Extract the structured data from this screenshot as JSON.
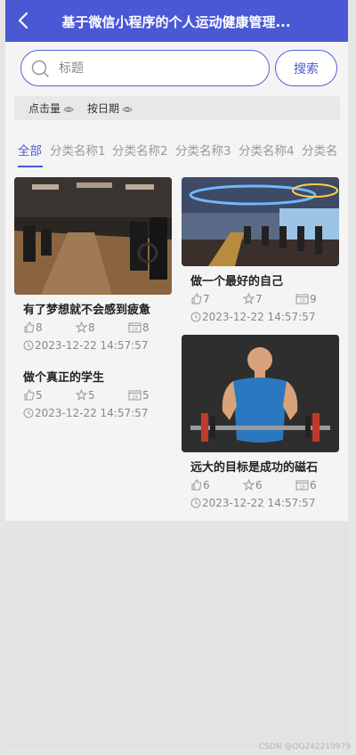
{
  "header": {
    "title": "基于微信小程序的个人运动健康管理..."
  },
  "search": {
    "placeholder": "标题",
    "button_label": "搜索"
  },
  "sort": {
    "clicks_label": "点击量",
    "date_label": "按日期"
  },
  "tabs": [
    "全部",
    "分类名称1",
    "分类名称2",
    "分类名称3",
    "分类名称4",
    "分类名"
  ],
  "cards": [
    {
      "title": "有了梦想就不会感到疲惫",
      "likes": "8",
      "favorites": "8",
      "views": "8",
      "date": "2023-12-22 14:57:57"
    },
    {
      "title": "做个真正的学生",
      "likes": "5",
      "favorites": "5",
      "views": "5",
      "date": "2023-12-22 14:57:57"
    },
    {
      "title": "做一个最好的自己",
      "likes": "7",
      "favorites": "7",
      "views": "9",
      "date": "2023-12-22 14:57:57"
    },
    {
      "title": "远大的目标是成功的磁石",
      "likes": "6",
      "favorites": "6",
      "views": "6",
      "date": "2023-12-22 14:57:57"
    }
  ],
  "watermark": "CSDN @QQ242219979",
  "colors": {
    "accent": "#4a58d6",
    "panel": "#f4f4f5",
    "muted": "#888888"
  }
}
